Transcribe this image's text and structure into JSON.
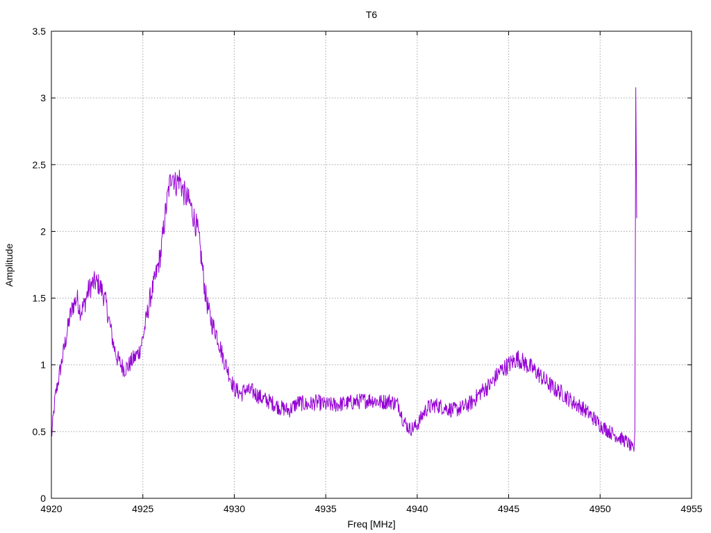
{
  "chart_data": {
    "type": "line",
    "title": "T6",
    "xlabel": "Freq [MHz]",
    "ylabel": "Amplitude",
    "xlim": [
      4920,
      4955
    ],
    "ylim": [
      0,
      3.5
    ],
    "xticks": [
      "4920",
      "4925",
      "4930",
      "4935",
      "4940",
      "4945",
      "4950",
      "4955"
    ],
    "yticks": [
      "0",
      "0.5",
      "1",
      "1.5",
      "2",
      "2.5",
      "3",
      "3.5"
    ],
    "grid": true,
    "legend": "none",
    "series_color": "#9400d3",
    "series": [
      {
        "x": [
          4920.0,
          4920.1,
          4920.2,
          4920.4,
          4920.6,
          4920.8,
          4921.0,
          4921.2,
          4921.4,
          4921.6,
          4921.8,
          4922.0,
          4922.2,
          4922.4,
          4922.6,
          4922.8,
          4923.0,
          4923.2,
          4923.4,
          4923.6,
          4923.8,
          4924.0,
          4924.2,
          4924.4,
          4924.6,
          4924.8,
          4925.0,
          4925.2,
          4925.4,
          4925.6,
          4925.8,
          4926.0,
          4926.2,
          4926.4,
          4926.6,
          4926.8,
          4927.0,
          4927.2,
          4927.4,
          4927.6,
          4927.8,
          4928.0,
          4928.2,
          4928.4,
          4928.6,
          4928.8,
          4929.0,
          4929.2,
          4929.4,
          4929.6,
          4929.8,
          4930.0,
          4930.2,
          4930.4,
          4930.6,
          4930.8,
          4931.0,
          4931.5,
          4932.0,
          4932.5,
          4933.0,
          4933.5,
          4934.0,
          4934.5,
          4935.0,
          4935.5,
          4936.0,
          4936.5,
          4937.0,
          4937.5,
          4938.0,
          4938.5,
          4939.0,
          4939.2,
          4939.4,
          4939.6,
          4939.8,
          4940.0,
          4940.2,
          4940.4,
          4940.6,
          4941.0,
          4941.5,
          4942.0,
          4942.5,
          4943.0,
          4943.5,
          4944.0,
          4944.5,
          4945.0,
          4945.5,
          4946.0,
          4946.5,
          4947.0,
          4947.5,
          4948.0,
          4948.5,
          4949.0,
          4949.5,
          4950.0,
          4950.5,
          4951.0,
          4951.5,
          4951.85,
          4951.9,
          4951.95,
          4952.0
        ],
        "y": [
          0.45,
          0.6,
          0.75,
          0.9,
          1.05,
          1.2,
          1.35,
          1.45,
          1.5,
          1.4,
          1.45,
          1.55,
          1.6,
          1.62,
          1.6,
          1.55,
          1.45,
          1.3,
          1.15,
          1.05,
          1.0,
          0.97,
          0.99,
          1.03,
          1.06,
          1.1,
          1.2,
          1.35,
          1.5,
          1.6,
          1.72,
          1.85,
          2.1,
          2.3,
          2.45,
          2.35,
          2.4,
          2.3,
          2.25,
          2.2,
          2.1,
          2.0,
          1.8,
          1.55,
          1.4,
          1.3,
          1.25,
          1.15,
          1.05,
          0.98,
          0.9,
          0.82,
          0.8,
          0.78,
          0.82,
          0.8,
          0.8,
          0.75,
          0.72,
          0.68,
          0.66,
          0.72,
          0.7,
          0.72,
          0.7,
          0.7,
          0.71,
          0.72,
          0.73,
          0.74,
          0.72,
          0.73,
          0.7,
          0.6,
          0.55,
          0.52,
          0.53,
          0.55,
          0.6,
          0.65,
          0.68,
          0.7,
          0.68,
          0.66,
          0.68,
          0.72,
          0.8,
          0.85,
          0.95,
          1.0,
          1.05,
          1.0,
          0.95,
          0.88,
          0.82,
          0.78,
          0.72,
          0.68,
          0.62,
          0.55,
          0.5,
          0.46,
          0.42,
          0.35,
          0.5,
          3.08,
          2.1
        ]
      }
    ]
  }
}
